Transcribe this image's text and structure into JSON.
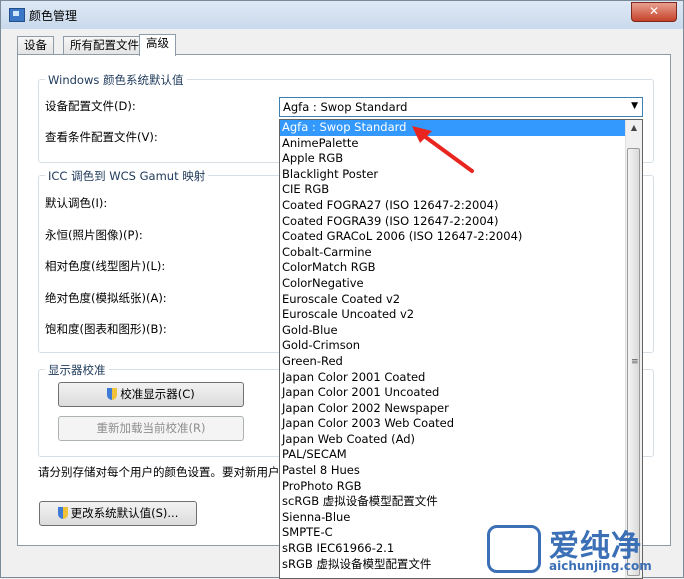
{
  "window": {
    "title": "颜色管理",
    "close_label": "✕"
  },
  "tabs": [
    {
      "label": "设备"
    },
    {
      "label": "所有配置文件"
    },
    {
      "label": "高级"
    }
  ],
  "windows_defaults": {
    "group_title": "Windows 颜色系统默认值",
    "device_profile_label": "设备配置文件(D):",
    "viewing_conditions_label": "查看条件配置文件(V):",
    "device_profile_value": "Agfa : Swop Standard"
  },
  "icc_mapping": {
    "group_title": "ICC 调色到 WCS Gamut 映射",
    "default_label": "默认调色(I):",
    "perceptual_label": "永恒(照片图像)(P):",
    "relative_label": "相对色度(线型图片)(L):",
    "absolute_label": "绝对色度(模拟纸张)(A):",
    "saturation_label": "饱和度(图表和图形)(B):"
  },
  "display_calibration": {
    "group_title": "显示器校准",
    "calibrate_button": "校准显示器(C)",
    "reload_button": "重新加载当前校准(R)"
  },
  "note_text": "请分别存储对每个用户的颜色设置。要对新用户和",
  "change_defaults_button": "更改系统默认值(S)...",
  "dropdown": {
    "selected_index": 0,
    "items": [
      "Agfa : Swop Standard",
      "AnimePalette",
      "Apple RGB",
      "Blacklight Poster",
      "CIE RGB",
      "Coated FOGRA27 (ISO 12647-2:2004)",
      "Coated FOGRA39 (ISO 12647-2:2004)",
      "Coated GRACoL 2006 (ISO 12647-2:2004)",
      "Cobalt-Carmine",
      "ColorMatch RGB",
      "ColorNegative",
      "Euroscale Coated v2",
      "Euroscale Uncoated v2",
      "Gold-Blue",
      "Gold-Crimson",
      "Green-Red",
      "Japan Color 2001 Coated",
      "Japan Color 2001 Uncoated",
      "Japan Color 2002 Newspaper",
      "Japan Color 2003 Web Coated",
      "Japan Web Coated (Ad)",
      "PAL/SECAM",
      "Pastel 8 Hues",
      "ProPhoto RGB",
      "scRGB 虚拟设备模型配置文件",
      "Sienna-Blue",
      "SMPTE-C",
      "sRGB IEC61966-2.1",
      "sRGB 虚拟设备模型配置文件"
    ]
  },
  "watermark": {
    "text": "爱纯净",
    "url_text": "aichunjing.com"
  },
  "colors": {
    "selection": "#3399ff",
    "annotation_arrow": "#e8261f",
    "watermark": "#3b6fb6"
  }
}
